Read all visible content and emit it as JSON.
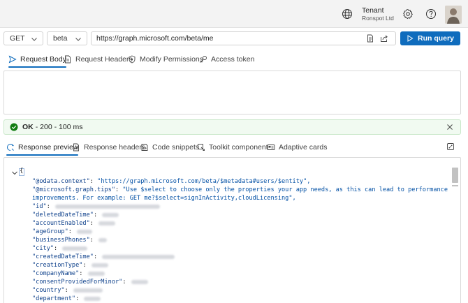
{
  "header": {
    "tenant_title": "Tenant",
    "tenant_name": "Ronspot Ltd"
  },
  "query": {
    "method": "GET",
    "version": "beta",
    "url": "https://graph.microsoft.com/beta/me",
    "run_label": "Run query"
  },
  "request_tabs": [
    {
      "label": "Request Body",
      "icon": "send-icon",
      "active": true
    },
    {
      "label": "Request Headers",
      "icon": "document-icon",
      "active": false
    },
    {
      "label": "Modify Permissions",
      "icon": "shield-icon",
      "active": false
    },
    {
      "label": "Access token",
      "icon": "key-icon",
      "active": false
    }
  ],
  "status": {
    "ok": "OK",
    "detail": "- 200 - 100 ms"
  },
  "response_tabs": [
    {
      "label": "Response preview",
      "icon": "preview-icon",
      "active": true
    },
    {
      "label": "Response headers",
      "icon": "document-icon",
      "active": false
    },
    {
      "label": "Code snippets",
      "icon": "code-icon",
      "active": false
    },
    {
      "label": "Toolkit component",
      "icon": "toolkit-icon",
      "active": false
    },
    {
      "label": "Adaptive cards",
      "icon": "card-icon",
      "active": false
    }
  ],
  "response": {
    "odata_context_key": "\"@odata.context\"",
    "odata_context_val": "\"https://graph.microsoft.com/beta/$metadata#users/$entity\",",
    "tips_key": "\"@microsoft.graph.tips\"",
    "tips_val_1": "\"Use $select to choose only the properties your app needs, as this can lead to performance",
    "tips_val_2": "improvements. For example: GET me?$select=signInActivity,cloudLicensing\",",
    "keys": [
      "\"id\"",
      "\"deletedDateTime\"",
      "\"accountEnabled\"",
      "\"ageGroup\"",
      "\"businessPhones\"",
      "\"city\"",
      "\"createdDateTime\"",
      "\"creationType\"",
      "\"companyName\"",
      "\"consentProvidedForMinor\"",
      "\"country\"",
      "\"department\""
    ]
  },
  "colors": {
    "accent": "#0f6cbd",
    "status_bg": "#f1faf1",
    "success": "#107c10"
  }
}
